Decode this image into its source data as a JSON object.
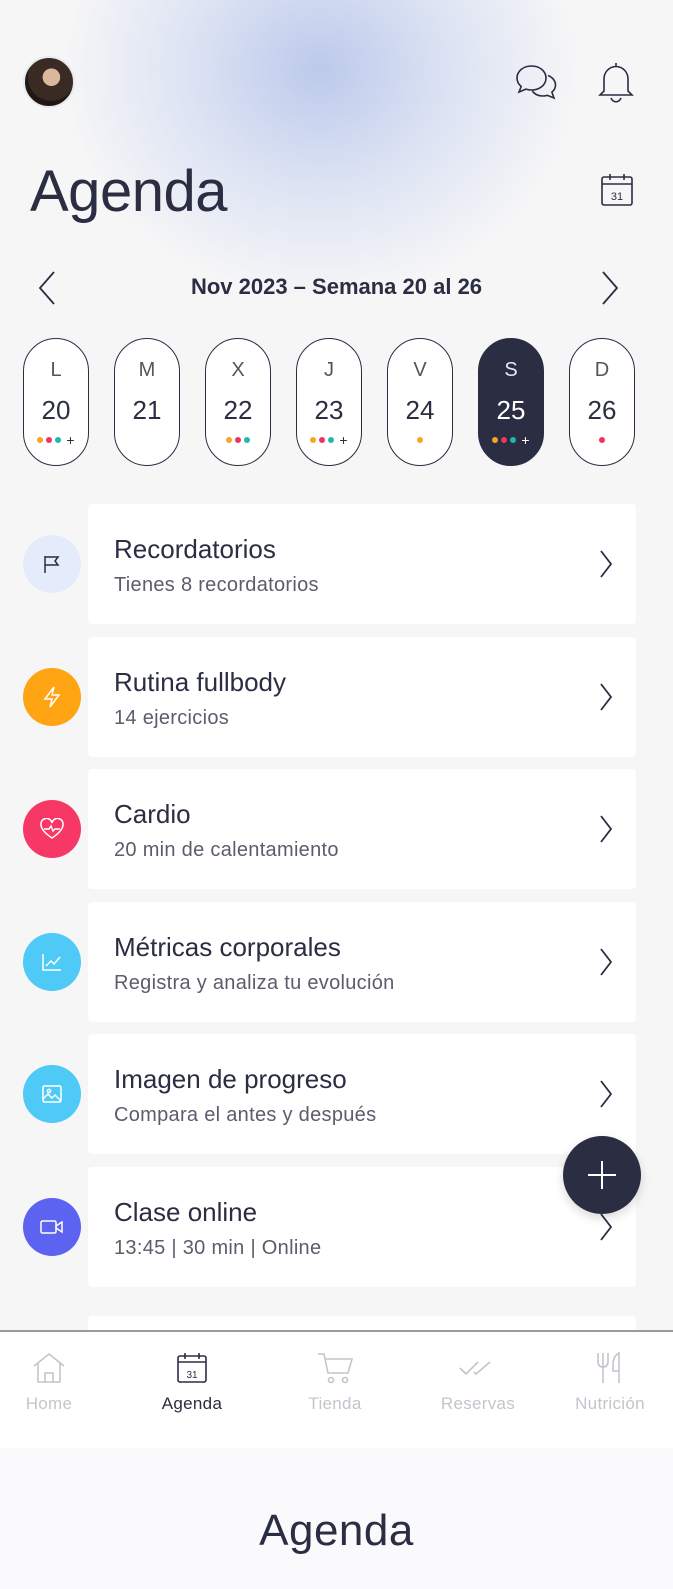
{
  "header": {
    "title": "Agenda",
    "icons": [
      "avatar",
      "chat-icon",
      "bell-icon",
      "calendar-icon"
    ]
  },
  "week": {
    "label": "Nov 2023 – Semana 20 al 26"
  },
  "days": [
    {
      "letter": "L",
      "number": "20",
      "dots": [
        "#f5a623",
        "#f0345f",
        "#23b7a8"
      ],
      "more": "+"
    },
    {
      "letter": "M",
      "number": "21",
      "dots": [],
      "more": ""
    },
    {
      "letter": "X",
      "number": "22",
      "dots": [
        "#f5a623",
        "#f0345f",
        "#23b7a8"
      ],
      "more": ""
    },
    {
      "letter": "J",
      "number": "23",
      "dots": [
        "#f5a623",
        "#f0345f",
        "#23b7a8"
      ],
      "more": "+"
    },
    {
      "letter": "V",
      "number": "24",
      "dots": [
        "#f5a623"
      ],
      "more": ""
    },
    {
      "letter": "S",
      "number": "25",
      "dots": [
        "#f5a623",
        "#f0345f",
        "#23b7a8"
      ],
      "more": "+",
      "active": true
    },
    {
      "letter": "D",
      "number": "26",
      "dots": [
        "#f0345f"
      ],
      "more": ""
    }
  ],
  "items": [
    {
      "title": "Recordatorios",
      "subtitle": "Tienes 8 recordatorios",
      "icon": "flag-icon",
      "color": "#e4ebfb"
    },
    {
      "title": "Rutina fullbody",
      "subtitle": "14 ejercicios",
      "icon": "bolt-icon",
      "color": "#ffa412"
    },
    {
      "title": "Cardio",
      "subtitle": "20 min de calentamiento",
      "icon": "heart-pulse-icon",
      "color": "#f73866"
    },
    {
      "title": "Métricas corporales",
      "subtitle": "Registra y analiza tu evolución",
      "icon": "chart-line-icon",
      "color": "#4fc9f5"
    },
    {
      "title": "Imagen de progreso",
      "subtitle": "Compara el antes y después",
      "icon": "image-icon",
      "color": "#4fc9f5"
    },
    {
      "title": "Clase online",
      "subtitle": "13:45 | 30 min | Online",
      "icon": "video-icon",
      "color": "#5b63f0"
    }
  ],
  "tabs": [
    {
      "label": "Home",
      "icon": "home-icon"
    },
    {
      "label": "Agenda",
      "icon": "calendar-icon",
      "active": true
    },
    {
      "label": "Tienda",
      "icon": "cart-icon"
    },
    {
      "label": "Reservas",
      "icon": "double-check-icon"
    },
    {
      "label": "Nutrición",
      "icon": "cutlery-icon"
    }
  ],
  "footer": {
    "title": "Agenda"
  },
  "colors": {
    "primary": "#2b2d42",
    "background": "#f6f6f7",
    "inactive": "#c4c4cc"
  }
}
